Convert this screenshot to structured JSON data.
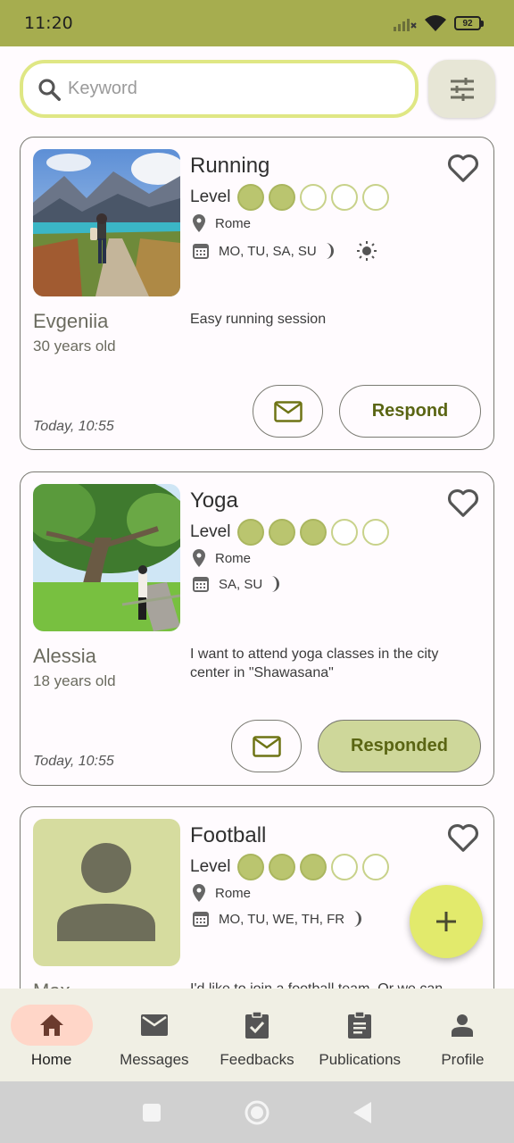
{
  "status_bar": {
    "time": "11:20",
    "battery": "92"
  },
  "search": {
    "placeholder": "Keyword",
    "value": ""
  },
  "posts": [
    {
      "activity": "Running",
      "level_label": "Level",
      "level": 2,
      "level_max": 5,
      "location": "Rome",
      "days": "MO, TU, SA, SU",
      "time_icons": [
        "moon-icon",
        "sun-icon"
      ],
      "name": "Evgeniia",
      "age": "30 years old",
      "description": "Easy running session",
      "posted": "Today, 10:55",
      "action": "Respond"
    },
    {
      "activity": "Yoga",
      "level_label": "Level",
      "level": 3,
      "level_max": 5,
      "location": "Rome",
      "days": "SA, SU",
      "time_icons": [
        "moon-icon"
      ],
      "name": "Alessia",
      "age": "18 years old",
      "description": "I want to attend yoga classes in the city center in \"Shawasana\"",
      "posted": "Today, 10:55",
      "action": "Responded"
    },
    {
      "activity": "Football",
      "level_label": "Level",
      "level": 3,
      "level_max": 5,
      "location": "Rome",
      "days": "MO, TU, WE, TH, FR",
      "time_icons": [
        "moon-icon"
      ],
      "name": "Max",
      "description": "I'd like to join a football team. Or we can"
    }
  ],
  "nav": {
    "items": [
      {
        "label": "Home",
        "icon": "home-icon",
        "active": true
      },
      {
        "label": "Messages",
        "icon": "mail-icon"
      },
      {
        "label": "Feedbacks",
        "icon": "clipboard-check-icon"
      },
      {
        "label": "Publications",
        "icon": "clipboard-list-icon"
      },
      {
        "label": "Profile",
        "icon": "person-icon"
      }
    ]
  },
  "colors": {
    "accent": "#a6ad4f",
    "search_border": "#dfe784",
    "level_fill": "#bac56f",
    "responded_bg": "#ced79a",
    "fab": "#e2ea6c",
    "nav_active": "#ffd6c8"
  }
}
